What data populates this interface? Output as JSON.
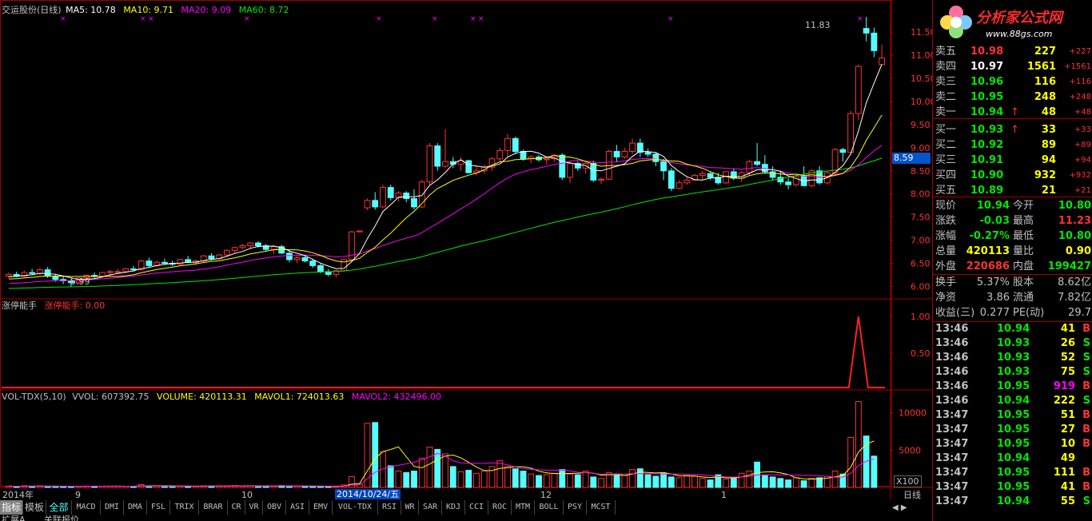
{
  "header": {
    "title": "交运股份(日线)",
    "ma5": "MA5: 10.78",
    "ma10": "MA10: 9.71",
    "ma20": "MA20: 9.09",
    "ma60": "MA60: 8.72",
    "high_mark": "11.83",
    "low_mark": "5.99",
    "current_price_flag": "8.59"
  },
  "colors": {
    "up": "#ff3232",
    "down": "#54ffff",
    "ma5": "#ffffff",
    "ma10": "#ffff00",
    "ma20": "#ff00ff",
    "ma60": "#00e600",
    "grid": "#a00000"
  },
  "price_axis": [
    "11.50",
    "11.00",
    "10.50",
    "10.00",
    "9.50",
    "9.00",
    "8.50",
    "8.00",
    "7.50",
    "7.00",
    "6.50",
    "6.00"
  ],
  "indicator": {
    "name": "涨停能手",
    "value_label": "涨停能手: 0.00",
    "axis": [
      "1.00",
      "0.50"
    ]
  },
  "volume": {
    "name": "VOL-TDX(5,10)",
    "vvol": "VVOL: 607392.75",
    "volume": "VOLUME: 420113.31",
    "mavol1": "MAVOL1: 724013.63",
    "mavol2": "MAVOL2: 432496.00",
    "axis": [
      "10000",
      "5000"
    ],
    "unit": "X100"
  },
  "time_axis": {
    "labels": [
      "2014年",
      "9",
      "10",
      "12",
      "1"
    ],
    "cursor_date": "2014/10/24/五",
    "period": "日线"
  },
  "tabs": [
    "指标",
    "模板",
    "全部",
    "MACD",
    "DMI",
    "DMA",
    "FSL",
    "TRIX",
    "BRAR",
    "CR",
    "VR",
    "OBV",
    "ASI",
    "EMV",
    "VOL-TDX",
    "RSI",
    "WR",
    "SAR",
    "KDJ",
    "CCI",
    "ROC",
    "MTM",
    "BOLL",
    "PSY",
    "MCST"
  ],
  "bottom_tabs": [
    "扩展A",
    "关联报价"
  ],
  "logo": {
    "name": "分析家公式网",
    "url": "www.88gs.com"
  },
  "order_book": [
    {
      "label": "卖五",
      "price": "10.98",
      "vol": "227",
      "chg": "+227",
      "pc": "up",
      "arrow": ""
    },
    {
      "label": "卖四",
      "price": "10.97",
      "vol": "1561",
      "chg": "+1561",
      "pc": "white",
      "arrow": ""
    },
    {
      "label": "卖三",
      "price": "10.96",
      "vol": "116",
      "chg": "+116",
      "pc": "green",
      "arrow": ""
    },
    {
      "label": "卖二",
      "price": "10.95",
      "vol": "248",
      "chg": "+248",
      "pc": "green",
      "arrow": ""
    },
    {
      "label": "卖一",
      "price": "10.94",
      "vol": "48",
      "chg": "+48",
      "pc": "green",
      "arrow": "↑"
    },
    {
      "label": "买一",
      "price": "10.93",
      "vol": "33",
      "chg": "+33",
      "pc": "green",
      "arrow": "↑"
    },
    {
      "label": "买二",
      "price": "10.92",
      "vol": "89",
      "chg": "+89",
      "pc": "green",
      "arrow": ""
    },
    {
      "label": "买三",
      "price": "10.91",
      "vol": "94",
      "chg": "+94",
      "pc": "green",
      "arrow": ""
    },
    {
      "label": "买四",
      "price": "10.90",
      "vol": "932",
      "chg": "+932",
      "pc": "green",
      "arrow": ""
    },
    {
      "label": "买五",
      "price": "10.89",
      "vol": "21",
      "chg": "+21",
      "pc": "green",
      "arrow": ""
    }
  ],
  "quote": [
    {
      "l1": "现价",
      "v1": "10.94",
      "c1": "green",
      "l2": "今开",
      "v2": "10.80",
      "c2": "green"
    },
    {
      "l1": "涨跌",
      "v1": "-0.03",
      "c1": "green",
      "l2": "最高",
      "v2": "11.23",
      "c2": "up"
    },
    {
      "l1": "涨幅",
      "v1": "-0.27%",
      "c1": "green",
      "l2": "最低",
      "v2": "10.80",
      "c2": "green"
    },
    {
      "l1": "总量",
      "v1": "420113",
      "c1": "yellow",
      "l2": "量比",
      "v2": "0.90",
      "c2": "yellow"
    },
    {
      "l1": "外盘",
      "v1": "220686",
      "c1": "up",
      "l2": "内盘",
      "v2": "199427",
      "c2": "green"
    }
  ],
  "fundamentals": [
    {
      "l1": "换手",
      "v1": "5.37%",
      "l2": "股本",
      "v2": "8.62亿"
    },
    {
      "l1": "净资",
      "v1": "3.86",
      "l2": "流通",
      "v2": "7.82亿"
    },
    {
      "l1": "收益(三)",
      "v1": "0.277",
      "l2": "PE(动)",
      "v2": "29.7"
    }
  ],
  "ticks": [
    {
      "time": "13:46",
      "price": "10.94",
      "vol": "41",
      "side": "B",
      "vc": "yellow"
    },
    {
      "time": "13:46",
      "price": "10.93",
      "vol": "26",
      "side": "S",
      "vc": "yellow"
    },
    {
      "time": "13:46",
      "price": "10.93",
      "vol": "52",
      "side": "S",
      "vc": "yellow"
    },
    {
      "time": "13:46",
      "price": "10.93",
      "vol": "75",
      "side": "S",
      "vc": "yellow"
    },
    {
      "time": "13:46",
      "price": "10.95",
      "vol": "919",
      "side": "B",
      "vc": "magenta"
    },
    {
      "time": "13:46",
      "price": "10.94",
      "vol": "222",
      "side": "S",
      "vc": "yellow"
    },
    {
      "time": "13:47",
      "price": "10.95",
      "vol": "51",
      "side": "B",
      "vc": "yellow"
    },
    {
      "time": "13:47",
      "price": "10.95",
      "vol": "27",
      "side": "B",
      "vc": "yellow"
    },
    {
      "time": "13:47",
      "price": "10.95",
      "vol": "10",
      "side": "B",
      "vc": "yellow"
    },
    {
      "time": "13:47",
      "price": "10.94",
      "vol": "49",
      "side": "",
      "vc": "yellow"
    },
    {
      "time": "13:47",
      "price": "10.95",
      "vol": "111",
      "side": "B",
      "vc": "yellow"
    },
    {
      "time": "13:47",
      "price": "10.95",
      "vol": "41",
      "side": "B",
      "vc": "yellow"
    },
    {
      "time": "13:47",
      "price": "10.94",
      "vol": "55",
      "side": "S",
      "vc": "yellow"
    }
  ],
  "chart_data": {
    "type": "candlestick",
    "price_range": [
      5.8,
      11.85
    ],
    "candles_ohlc": [
      [
        6.22,
        6.3,
        6.18,
        6.26
      ],
      [
        6.26,
        6.32,
        6.2,
        6.22
      ],
      [
        6.22,
        6.34,
        6.2,
        6.3
      ],
      [
        6.3,
        6.38,
        6.24,
        6.28
      ],
      [
        6.28,
        6.4,
        6.25,
        6.36
      ],
      [
        6.36,
        6.42,
        6.18,
        6.22
      ],
      [
        6.22,
        6.26,
        6.1,
        6.15
      ],
      [
        6.15,
        6.22,
        6.05,
        6.12
      ],
      [
        6.12,
        6.16,
        5.99,
        6.08
      ],
      [
        6.08,
        6.2,
        6.05,
        6.18
      ],
      [
        6.18,
        6.26,
        6.12,
        6.24
      ],
      [
        6.24,
        6.3,
        6.18,
        6.22
      ],
      [
        6.22,
        6.32,
        6.2,
        6.3
      ],
      [
        6.3,
        6.36,
        6.24,
        6.32
      ],
      [
        6.32,
        6.38,
        6.28,
        6.32
      ],
      [
        6.32,
        6.4,
        6.28,
        6.38
      ],
      [
        6.38,
        6.44,
        6.32,
        6.36
      ],
      [
        6.36,
        6.58,
        6.34,
        6.55
      ],
      [
        6.55,
        6.62,
        6.4,
        6.45
      ],
      [
        6.45,
        6.56,
        6.42,
        6.52
      ],
      [
        6.52,
        6.6,
        6.46,
        6.5
      ],
      [
        6.5,
        6.56,
        6.44,
        6.48
      ],
      [
        6.48,
        6.6,
        6.46,
        6.58
      ],
      [
        6.58,
        6.66,
        6.5,
        6.52
      ],
      [
        6.52,
        6.58,
        6.46,
        6.55
      ],
      [
        6.55,
        6.68,
        6.52,
        6.66
      ],
      [
        6.66,
        6.72,
        6.56,
        6.6
      ],
      [
        6.6,
        6.7,
        6.58,
        6.68
      ],
      [
        6.68,
        6.8,
        6.64,
        6.78
      ],
      [
        6.78,
        6.86,
        6.72,
        6.84
      ],
      [
        6.84,
        6.92,
        6.8,
        6.88
      ],
      [
        6.88,
        6.96,
        6.82,
        6.94
      ],
      [
        6.94,
        6.98,
        6.84,
        6.88
      ],
      [
        6.88,
        6.92,
        6.76,
        6.8
      ],
      [
        6.8,
        6.9,
        6.7,
        6.86
      ],
      [
        6.86,
        6.9,
        6.7,
        6.72
      ],
      [
        6.72,
        6.78,
        6.52,
        6.58
      ],
      [
        6.58,
        6.66,
        6.5,
        6.62
      ],
      [
        6.62,
        6.66,
        6.52,
        6.55
      ],
      [
        6.55,
        6.6,
        6.4,
        6.45
      ],
      [
        6.45,
        6.5,
        6.28,
        6.32
      ],
      [
        6.32,
        6.38,
        6.22,
        6.26
      ],
      [
        6.26,
        6.36,
        6.2,
        6.34
      ],
      [
        6.34,
        6.6,
        6.32,
        6.58
      ],
      [
        6.58,
        7.2,
        6.56,
        7.18
      ],
      [
        7.18,
        7.2,
        7.18,
        7.2
      ],
      [
        7.7,
        7.9,
        7.65,
        7.86
      ],
      [
        7.86,
        8.04,
        7.66,
        7.72
      ],
      [
        7.72,
        8.2,
        7.7,
        8.14
      ],
      [
        8.14,
        8.2,
        7.86,
        7.92
      ],
      [
        7.92,
        8.06,
        7.84,
        8.02
      ],
      [
        8.02,
        8.06,
        7.82,
        7.9
      ],
      [
        7.9,
        8.1,
        7.66,
        7.72
      ],
      [
        7.72,
        8.3,
        7.7,
        8.26
      ],
      [
        8.26,
        9.1,
        8.2,
        9.04
      ],
      [
        9.04,
        9.1,
        8.5,
        8.6
      ],
      [
        8.6,
        9.4,
        8.56,
        8.7
      ],
      [
        8.7,
        8.8,
        8.56,
        8.64
      ],
      [
        8.64,
        8.8,
        8.5,
        8.72
      ],
      [
        8.72,
        8.74,
        8.44,
        8.46
      ],
      [
        8.46,
        8.6,
        8.4,
        8.5
      ],
      [
        8.5,
        8.64,
        8.44,
        8.58
      ],
      [
        8.58,
        8.8,
        8.5,
        8.76
      ],
      [
        8.76,
        9.0,
        8.7,
        8.94
      ],
      [
        8.94,
        9.3,
        8.8,
        9.2
      ],
      [
        9.2,
        9.24,
        8.86,
        8.92
      ],
      [
        8.92,
        8.96,
        8.72,
        8.76
      ],
      [
        8.76,
        8.84,
        8.66,
        8.8
      ],
      [
        8.8,
        8.84,
        8.7,
        8.74
      ],
      [
        8.74,
        8.8,
        8.64,
        8.76
      ],
      [
        8.76,
        8.86,
        8.7,
        8.84
      ],
      [
        8.84,
        8.88,
        8.3,
        8.36
      ],
      [
        8.36,
        8.7,
        8.24,
        8.66
      ],
      [
        8.66,
        8.7,
        8.5,
        8.56
      ],
      [
        8.56,
        8.7,
        8.44,
        8.66
      ],
      [
        8.66,
        8.72,
        8.26,
        8.3
      ],
      [
        8.3,
        8.36,
        8.22,
        8.32
      ],
      [
        8.32,
        8.96,
        8.3,
        8.92
      ],
      [
        8.92,
        9.06,
        8.7,
        8.8
      ],
      [
        8.8,
        9.0,
        8.76,
        8.92
      ],
      [
        8.92,
        9.2,
        8.86,
        9.1
      ],
      [
        9.1,
        9.2,
        8.8,
        8.9
      ],
      [
        8.9,
        8.98,
        8.8,
        8.86
      ],
      [
        8.86,
        8.9,
        8.6,
        8.7
      ],
      [
        8.7,
        8.76,
        8.3,
        8.5
      ],
      [
        8.5,
        8.56,
        8.06,
        8.12
      ],
      [
        8.12,
        8.3,
        8.1,
        8.24
      ],
      [
        8.24,
        8.36,
        8.2,
        8.3
      ],
      [
        8.3,
        8.44,
        8.28,
        8.4
      ],
      [
        8.4,
        8.5,
        8.3,
        8.44
      ],
      [
        8.44,
        8.48,
        8.3,
        8.36
      ],
      [
        8.36,
        8.46,
        8.2,
        8.24
      ],
      [
        8.24,
        8.5,
        8.22,
        8.48
      ],
      [
        8.48,
        8.56,
        8.3,
        8.34
      ],
      [
        8.34,
        8.5,
        8.26,
        8.46
      ],
      [
        8.46,
        8.74,
        8.4,
        8.7
      ],
      [
        8.7,
        9.1,
        8.6,
        8.64
      ],
      [
        8.64,
        8.84,
        8.44,
        8.48
      ],
      [
        8.48,
        8.6,
        8.3,
        8.36
      ],
      [
        8.36,
        8.48,
        8.2,
        8.26
      ],
      [
        8.26,
        8.34,
        8.1,
        8.2
      ],
      [
        8.2,
        8.4,
        8.16,
        8.38
      ],
      [
        8.38,
        8.6,
        8.16,
        8.18
      ],
      [
        8.18,
        8.54,
        8.14,
        8.5
      ],
      [
        8.5,
        8.6,
        8.2,
        8.24
      ],
      [
        8.24,
        8.5,
        8.2,
        8.46
      ],
      [
        8.46,
        9.0,
        8.42,
        8.96
      ],
      [
        8.96,
        9.0,
        8.7,
        8.9
      ],
      [
        8.9,
        9.8,
        8.86,
        9.74
      ],
      [
        9.74,
        10.8,
        9.6,
        10.76
      ],
      [
        11.58,
        11.83,
        11.3,
        11.48
      ],
      [
        11.48,
        11.6,
        10.96,
        11.1
      ],
      [
        10.8,
        11.23,
        10.8,
        10.94
      ]
    ],
    "ma5_final": 10.78,
    "ma10_final": 9.71,
    "ma20_final": 9.09,
    "ma60_final": 8.72,
    "volume_x100": [
      180,
      120,
      220,
      160,
      200,
      150,
      140,
      160,
      130,
      170,
      190,
      150,
      170,
      160,
      180,
      150,
      160,
      380,
      200,
      210,
      150,
      140,
      190,
      170,
      160,
      200,
      180,
      190,
      210,
      240,
      190,
      220,
      180,
      200,
      170,
      240,
      210,
      180,
      160,
      140,
      120,
      110,
      180,
      320,
      1450,
      460,
      8600,
      8700,
      4800,
      2900,
      2200,
      2000,
      2200,
      3900,
      5400,
      5100,
      4500,
      2800,
      2100,
      2300,
      1900,
      2200,
      2800,
      3600,
      2800,
      2500,
      2200,
      1800,
      1600,
      1700,
      1900,
      2400,
      1800,
      1700,
      2200,
      1400,
      1200,
      2000,
      1800,
      1600,
      2400,
      2500,
      1700,
      1500,
      1900,
      1400,
      1300,
      1600,
      1500,
      1200,
      1000,
      1700,
      1100,
      1300,
      1900,
      2200,
      3400,
      1600,
      1400,
      1200,
      1000,
      1300,
      900,
      1200,
      1300,
      1500,
      2200,
      1800,
      6700,
      11500,
      6900,
      4200
    ],
    "indicator_values": "0 everywhere except spike 1.00 near 2015-01 limit-up day"
  }
}
